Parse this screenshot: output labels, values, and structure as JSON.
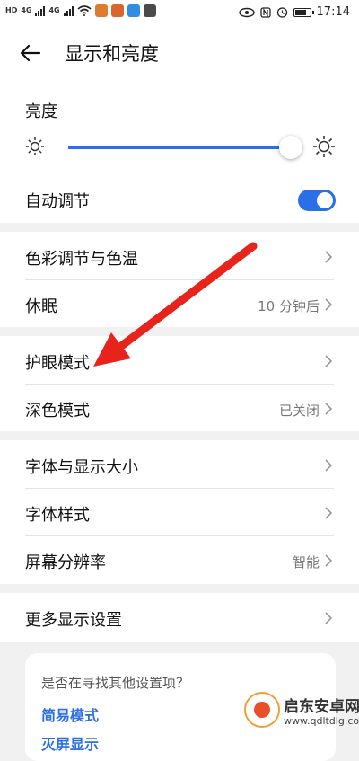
{
  "status_bar": {
    "left_badges": [
      "HD",
      "4G",
      "4G"
    ],
    "time": "17:14",
    "battery_level": 0.8,
    "app_icons": [
      {
        "name": "bell-app-icon",
        "color": "#e07a2e"
      },
      {
        "name": "fox-app-icon",
        "color": "#d9662b"
      },
      {
        "name": "blue-app-icon",
        "color": "#2f8de4"
      },
      {
        "name": "chat-app-icon",
        "color": "#4a4a4a"
      }
    ]
  },
  "header": {
    "title": "显示和亮度"
  },
  "brightness": {
    "label": "亮度",
    "level": 1.0
  },
  "auto_adjust": {
    "label": "自动调节",
    "on": true
  },
  "group1": [
    {
      "label": "色彩调节与色温",
      "value": ""
    },
    {
      "label": "休眠",
      "value": "10 分钟后"
    }
  ],
  "group2": [
    {
      "label": "护眼模式",
      "value": ""
    },
    {
      "label": "深色模式",
      "value": "已关闭"
    }
  ],
  "group3": [
    {
      "label": "字体与显示大小",
      "value": ""
    },
    {
      "label": "字体样式",
      "value": ""
    },
    {
      "label": "屏幕分辨率",
      "value": "智能"
    }
  ],
  "group4": [
    {
      "label": "更多显示设置",
      "value": ""
    }
  ],
  "suggestions": {
    "question": "是否在寻找其他设置项？",
    "links": [
      "简易模式",
      "灭屏显示"
    ]
  },
  "watermark": {
    "title": "启东安卓网",
    "url": "www.qdltdlg.com"
  },
  "colors": {
    "accent": "#2b6fe6",
    "annotation_arrow": "#e8231c"
  }
}
